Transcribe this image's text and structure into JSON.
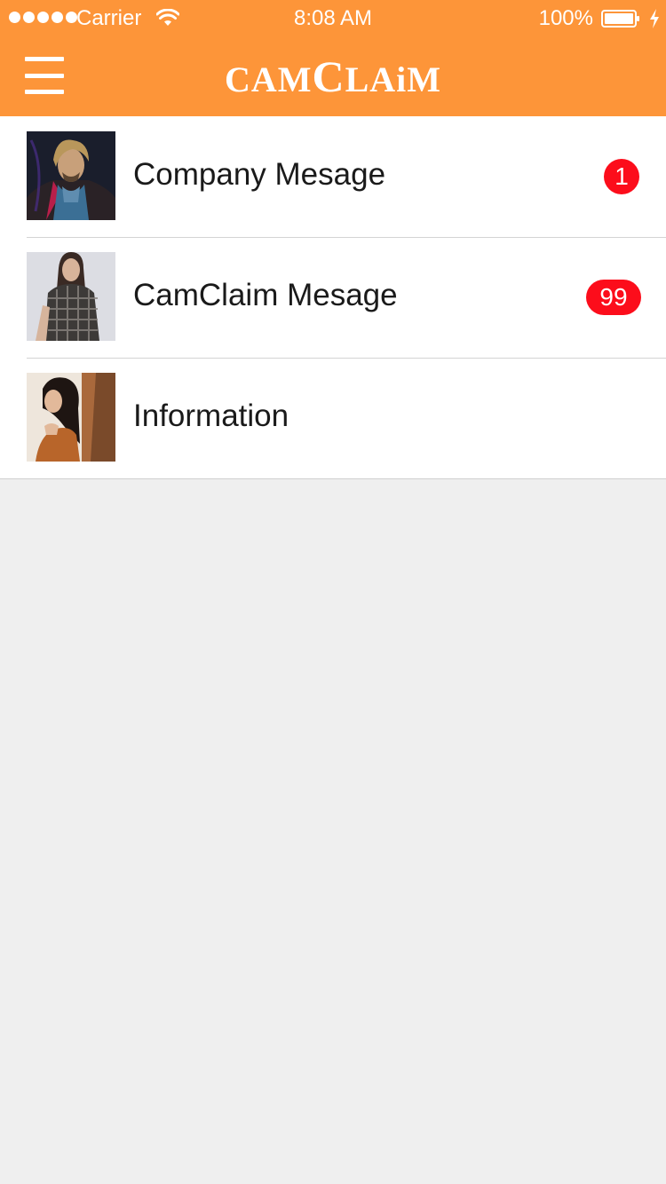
{
  "status_bar": {
    "carrier": "Carrier",
    "time": "8:08 AM",
    "battery": "100%"
  },
  "navbar": {
    "logo_prefix": "CAM",
    "logo_c": "C",
    "logo_suffix": "LAiM",
    "menu_icon": "hamburger-menu-icon"
  },
  "colors": {
    "navbar_bg": "#fd9539",
    "badge_bg": "#fc0d1b",
    "page_bg": "#efefef"
  },
  "messages": [
    {
      "label": "Company Mesage",
      "badge": "1"
    },
    {
      "label": "CamClaim Mesage",
      "badge": "99"
    },
    {
      "label": "Information",
      "badge": ""
    }
  ]
}
